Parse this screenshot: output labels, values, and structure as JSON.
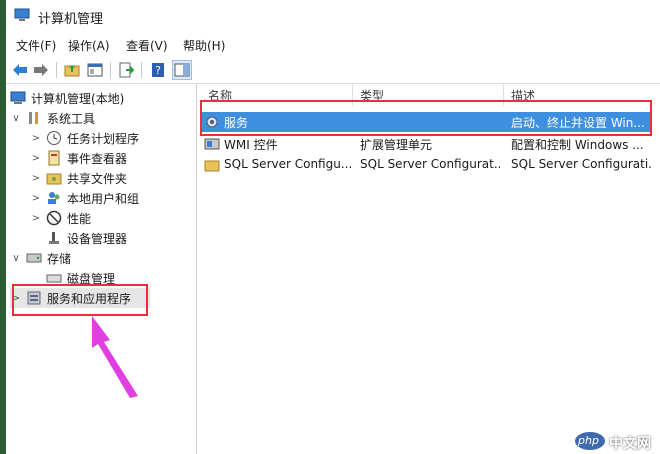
{
  "window": {
    "title": "计算机管理"
  },
  "menu": [
    "文件(F)",
    "操作(A)",
    "查看(V)",
    "帮助(H)"
  ],
  "tree": {
    "root": "计算机管理(本地)",
    "system_tools": "系统工具",
    "task_scheduler": "任务计划程序",
    "event_viewer": "事件查看器",
    "shared_folders": "共享文件夹",
    "local_users": "本地用户和组",
    "performance": "性能",
    "device_manager": "设备管理器",
    "storage": "存储",
    "disk_management": "磁盘管理",
    "services_apps": "服务和应用程序"
  },
  "list": {
    "headers": {
      "name": "名称",
      "type": "类型",
      "desc": "描述"
    },
    "rows": [
      {
        "name": "服务",
        "type": "",
        "desc": "启动、终止并设置 Win..."
      },
      {
        "name": "WMI 控件",
        "type": "扩展管理单元",
        "desc": "配置和控制 Windows ..."
      },
      {
        "name": "SQL Server Configu...",
        "type": "SQL Server Configurat...",
        "desc": "SQL Server Configurati..."
      }
    ]
  },
  "watermark": {
    "brand": "php",
    "text": "中文网"
  },
  "colors": {
    "selection": "#3f8fe0",
    "highlight_box": "#e8303a",
    "arrow": "#e040e0"
  }
}
